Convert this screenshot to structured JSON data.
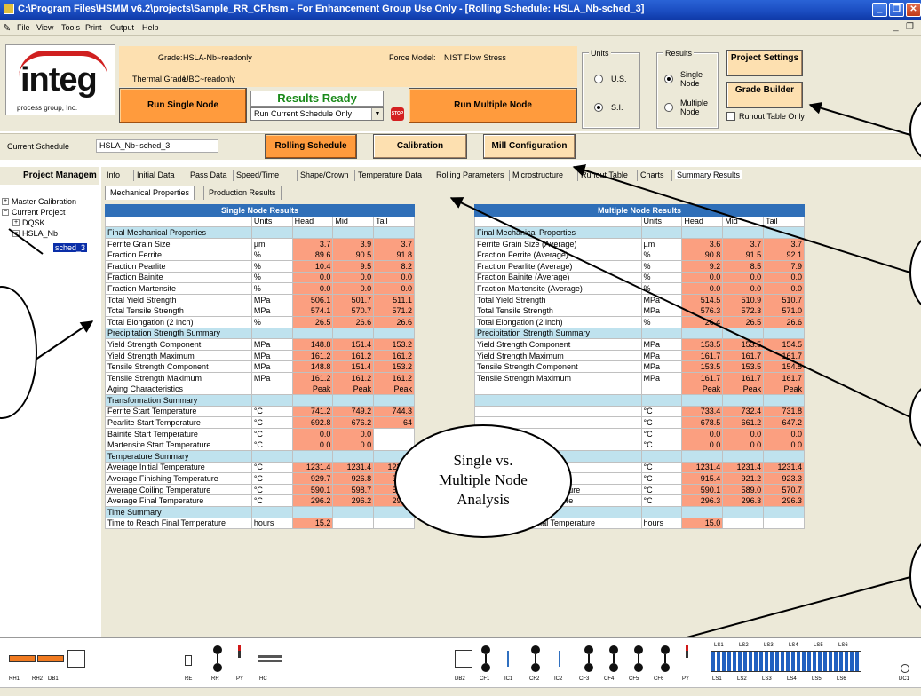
{
  "window": {
    "title": "C:\\Program Files\\HSMM v6.2\\projects\\Sample_RR_CF.hsm - For Enhancement Group Use Only - [Rolling Schedule: HSLA_Nb-sched_3]",
    "min": "_",
    "max": "❐",
    "close": "✕"
  },
  "menu": {
    "items": [
      "File",
      "View",
      "Tools",
      "Print",
      "Output",
      "Help"
    ],
    "mdi_min": "_",
    "mdi_restore": "❐"
  },
  "logo": {
    "text": "integ",
    "sub": "process group, Inc."
  },
  "header": {
    "grade_label": "Grade:",
    "grade_value": "HSLA-Nb~readonly",
    "thermal_label": "Thermal Grade:",
    "thermal_value": "UBC~readonly",
    "force_label": "Force Model:",
    "force_value": "NIST Flow Stress",
    "run_single": "Run Single Node",
    "results_ready": "Results Ready",
    "schedule_select": "Run Current Schedule Only",
    "stop": "STOP",
    "run_multiple": "Run Multiple Node"
  },
  "units": {
    "title": "Units",
    "us": "U.S.",
    "si": "S.I.",
    "selected": "S.I."
  },
  "results": {
    "title": "Results",
    "single": "Single Node",
    "multiple": "Multiple Node",
    "selected": "Single Node"
  },
  "settings": {
    "project": "Project Settings",
    "grade_builder": "Grade Builder",
    "runout_only": "Runout Table Only"
  },
  "schedule": {
    "label": "Current Schedule",
    "value": "HSLA_Nb~sched_3",
    "rolling": "Rolling Schedule",
    "calibration": "Calibration",
    "mill": "Mill Configuration"
  },
  "sidebar": {
    "title": "Project Managem",
    "tree": [
      {
        "label": "Master Calibration",
        "expander": "+"
      },
      {
        "label": "Current Project",
        "expander": "−"
      },
      {
        "label": "DQSK",
        "expander": "+"
      },
      {
        "label": "HSLA_Nb",
        "expander": "−"
      },
      {
        "label": "sched_3",
        "expander": ""
      }
    ]
  },
  "tabs": [
    "Info",
    "Initial Data",
    "Pass Data",
    "Speed/Time",
    "Shape/Crown",
    "Temperature Data",
    "Rolling Parameters",
    "Microstructure",
    "Runout Table",
    "Charts",
    "Summary Results"
  ],
  "subtabs": [
    "Mechanical Properties",
    "Production Results"
  ],
  "single_table": {
    "title": "Single Node Results",
    "columns": [
      "",
      "Units",
      "Head",
      "Mid",
      "Tail"
    ],
    "rows": [
      {
        "s": true,
        "label": "Final Mechanical Properties"
      },
      {
        "label": "Ferrite Grain Size",
        "u": "µm",
        "v": [
          "3.7",
          "3.9",
          "3.7"
        ]
      },
      {
        "label": "Fraction Ferrite",
        "u": "%",
        "v": [
          "89.6",
          "90.5",
          "91.8"
        ]
      },
      {
        "label": "Fraction Pearlite",
        "u": "%",
        "v": [
          "10.4",
          "9.5",
          "8.2"
        ]
      },
      {
        "label": "Fraction Bainite",
        "u": "%",
        "v": [
          "0.0",
          "0.0",
          "0.0"
        ]
      },
      {
        "label": "Fraction Martensite",
        "u": "%",
        "v": [
          "0.0",
          "0.0",
          "0.0"
        ]
      },
      {
        "label": "Total Yield Strength",
        "u": "MPa",
        "v": [
          "506.1",
          "501.7",
          "511.1"
        ]
      },
      {
        "label": "Total Tensile Strength",
        "u": "MPa",
        "v": [
          "574.1",
          "570.7",
          "571.2"
        ]
      },
      {
        "label": "Total Elongation (2 inch)",
        "u": "%",
        "v": [
          "26.5",
          "26.6",
          "26.6"
        ]
      },
      {
        "s": true,
        "label": "Precipitation Strength Summary"
      },
      {
        "label": "Yield Strength Component",
        "u": "MPa",
        "v": [
          "148.8",
          "151.4",
          "153.2"
        ]
      },
      {
        "label": "Yield Strength Maximum",
        "u": "MPa",
        "v": [
          "161.2",
          "161.2",
          "161.2"
        ]
      },
      {
        "label": "Tensile Strength Component",
        "u": "MPa",
        "v": [
          "148.8",
          "151.4",
          "153.2"
        ]
      },
      {
        "label": "Tensile Strength Maximum",
        "u": "MPa",
        "v": [
          "161.2",
          "161.2",
          "161.2"
        ]
      },
      {
        "label": "Aging Characteristics",
        "u": "",
        "v": [
          "Peak",
          "Peak",
          "Peak"
        ]
      },
      {
        "s": true,
        "label": "Transformation Summary"
      },
      {
        "label": "Ferrite Start Temperature",
        "u": "°C",
        "v": [
          "741.2",
          "749.2",
          "744.3"
        ]
      },
      {
        "label": "Pearlite Start Temperature",
        "u": "°C",
        "v": [
          "692.8",
          "676.2",
          "64"
        ]
      },
      {
        "label": "Bainite Start Temperature",
        "u": "°C",
        "v": [
          "0.0",
          "0.0",
          ""
        ]
      },
      {
        "label": "Martensite Start Temperature",
        "u": "°C",
        "v": [
          "0.0",
          "0.0",
          ""
        ]
      },
      {
        "s": true,
        "label": "Temperature Summary"
      },
      {
        "label": "Average Initial Temperature",
        "u": "°C",
        "v": [
          "1231.4",
          "1231.4",
          "1231.4"
        ]
      },
      {
        "label": "Average Finishing Temperature",
        "u": "°C",
        "v": [
          "929.7",
          "926.8",
          "926.9"
        ]
      },
      {
        "label": "Average Coiling Temperature",
        "u": "°C",
        "v": [
          "590.1",
          "598.7",
          "569.1"
        ]
      },
      {
        "label": "Average Final Temperature",
        "u": "°C",
        "v": [
          "296.2",
          "296.2",
          "296.2"
        ]
      },
      {
        "s": true,
        "label": "Time Summary"
      },
      {
        "label": "Time to Reach Final Temperature",
        "u": "hours",
        "v": [
          "15.2",
          "",
          ""
        ]
      }
    ]
  },
  "multiple_table": {
    "title": "Multiple Node Results",
    "columns": [
      "",
      "Units",
      "Head",
      "Mid",
      "Tail"
    ],
    "rows": [
      {
        "s": true,
        "label": "Final Mechanical Properties"
      },
      {
        "label": "Ferrite Grain Size (Average)",
        "u": "µm",
        "v": [
          "3.6",
          "3.7",
          "3.7"
        ]
      },
      {
        "label": "Fraction Ferrite (Average)",
        "u": "%",
        "v": [
          "90.8",
          "91.5",
          "92.1"
        ]
      },
      {
        "label": "Fraction Pearlite (Average)",
        "u": "%",
        "v": [
          "9.2",
          "8.5",
          "7.9"
        ]
      },
      {
        "label": "Fraction Bainite (Average)",
        "u": "%",
        "v": [
          "0.0",
          "0.0",
          "0.0"
        ]
      },
      {
        "label": "Fraction Martensite (Average)",
        "u": "%",
        "v": [
          "0.0",
          "0.0",
          "0.0"
        ]
      },
      {
        "label": "Total Yield Strength",
        "u": "MPa",
        "v": [
          "514.5",
          "510.9",
          "510.7"
        ]
      },
      {
        "label": "Total Tensile Strength",
        "u": "MPa",
        "v": [
          "576.3",
          "572.3",
          "571.0"
        ]
      },
      {
        "label": "Total Elongation (2 inch)",
        "u": "%",
        "v": [
          "26.4",
          "26.5",
          "26.6"
        ]
      },
      {
        "s": true,
        "label": "Precipitation Strength Summary"
      },
      {
        "label": "Yield Strength Component",
        "u": "MPa",
        "v": [
          "153.5",
          "153.5",
          "154.5"
        ]
      },
      {
        "label": "Yield Strength Maximum",
        "u": "MPa",
        "v": [
          "161.7",
          "161.7",
          "161.7"
        ]
      },
      {
        "label": "Tensile Strength Component",
        "u": "MPa",
        "v": [
          "153.5",
          "153.5",
          "154.5"
        ]
      },
      {
        "label": "Tensile Strength Maximum",
        "u": "MPa",
        "v": [
          "161.7",
          "161.7",
          "161.7"
        ]
      },
      {
        "label": "",
        "u": "",
        "v": [
          "Peak",
          "Peak",
          "Peak"
        ]
      },
      {
        "s": true,
        "label": ""
      },
      {
        "label": "",
        "u": "°C",
        "v": [
          "733.4",
          "732.4",
          "731.8"
        ]
      },
      {
        "label": "",
        "u": "°C",
        "v": [
          "678.5",
          "661.2",
          "647.2"
        ]
      },
      {
        "label": "",
        "u": "°C",
        "v": [
          "0.0",
          "0.0",
          "0.0"
        ]
      },
      {
        "label": "",
        "u": "°C",
        "v": [
          "0.0",
          "0.0",
          "0.0"
        ]
      },
      {
        "s": true,
        "label": ""
      },
      {
        "label": "",
        "u": "°C",
        "v": [
          "1231.4",
          "1231.4",
          "1231.4"
        ]
      },
      {
        "label": "",
        "u": "°C",
        "v": [
          "915.4",
          "921.2",
          "923.3"
        ]
      },
      {
        "label": "Average Coiling Temperature",
        "u": "°C",
        "v": [
          "590.1",
          "589.0",
          "570.7"
        ]
      },
      {
        "label": "Average Final Temperature",
        "u": "°C",
        "v": [
          "296.3",
          "296.3",
          "296.3"
        ]
      },
      {
        "s": true,
        "label": "Time Summary"
      },
      {
        "label": "Time to Reach Final Temperature",
        "u": "hours",
        "v": [
          "15.0",
          "",
          ""
        ]
      }
    ]
  },
  "callout": {
    "line1": "Single vs.",
    "line2": "Multiple Node",
    "line3": "Analysis"
  },
  "mill": {
    "labels": [
      "RH1",
      "RH2",
      "DB1",
      "RE",
      "RR",
      "PY",
      "HC",
      "DB2",
      "CF1",
      "IC1",
      "CF2",
      "IC2",
      "CF3",
      "CF4",
      "CF5",
      "CF6",
      "PY",
      "LS1",
      "LS2",
      "LS3",
      "LS4",
      "LS5",
      "LS6",
      "DC1"
    ],
    "ls_top": [
      "LS1",
      "LS2",
      "LS3",
      "LS4",
      "LS5",
      "LS6"
    ]
  },
  "colors": {
    "value_cell": "#fb9f80",
    "section_row": "#bfe2ee",
    "table_title": "#2f6fb8",
    "run_button": "#ff9b3d",
    "results_ready": "#1a8a1a"
  }
}
